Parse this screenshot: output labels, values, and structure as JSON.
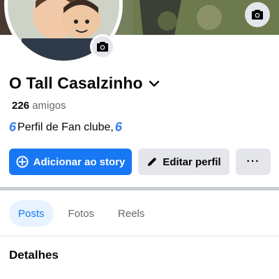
{
  "profile": {
    "name": "O Tall Casalzinho",
    "friends_count": "226",
    "friends_label": "amigos",
    "bio_text": "Perfil de Fan clube,",
    "bio_emoji": "6"
  },
  "actions": {
    "add_story": "Adicionar ao story",
    "edit_profile": "Editar perfil",
    "more": "···"
  },
  "tabs": [
    {
      "label": "Posts",
      "active": true
    },
    {
      "label": "Fotos",
      "active": false
    },
    {
      "label": "Reels",
      "active": false
    }
  ],
  "section": {
    "details_title": "Detalhes"
  },
  "colors": {
    "accent": "#1877f2",
    "button_gray": "#e4e6eb",
    "text_secondary": "#65676b"
  },
  "icons": [
    "camera-icon",
    "chevron-down-icon",
    "add-circle-icon",
    "pencil-icon",
    "more-icon"
  ]
}
